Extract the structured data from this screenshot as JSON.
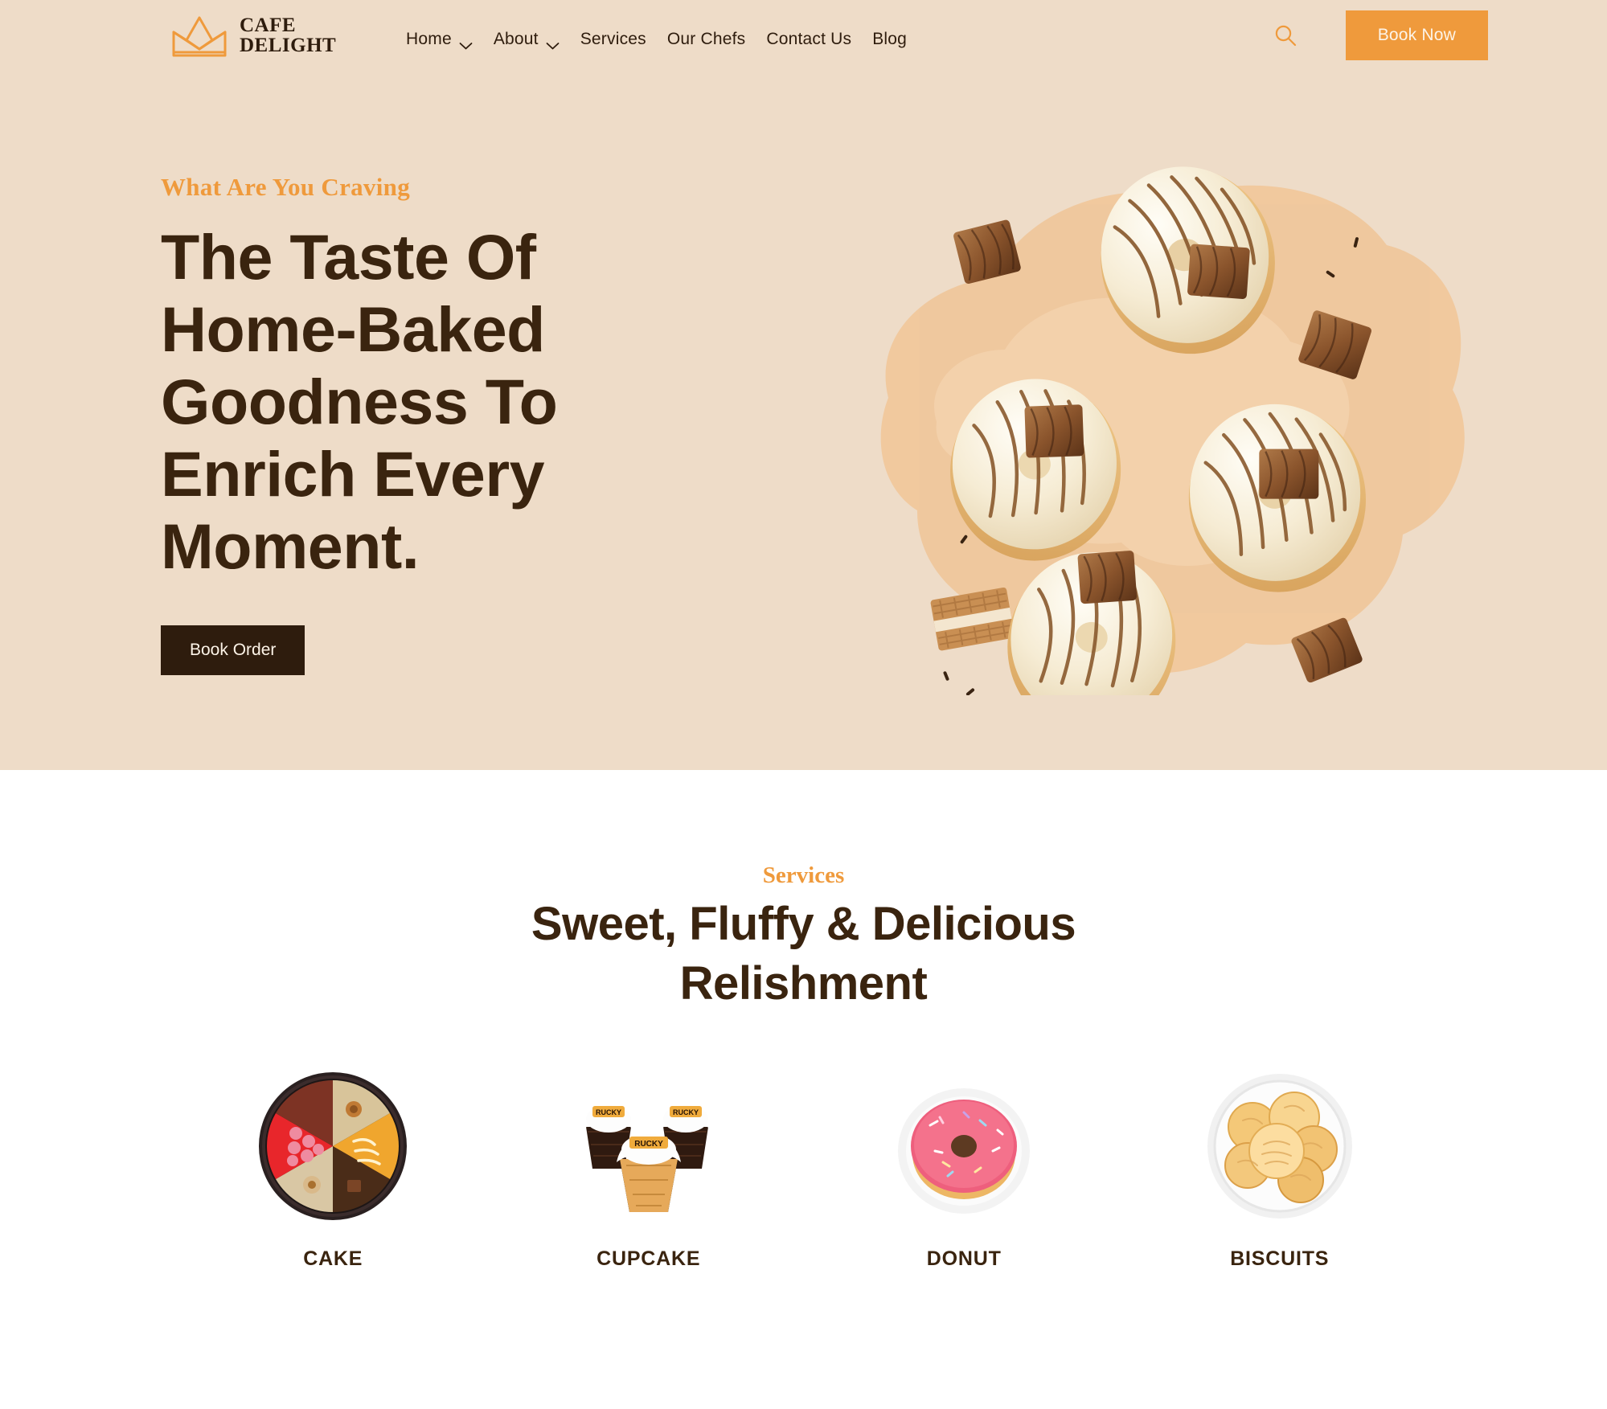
{
  "header": {
    "brand": {
      "icon": "crown-icon",
      "line1": "CAFE",
      "line2": "DELIGHT"
    },
    "nav": [
      {
        "label": "Home",
        "has_dropdown": true,
        "icon": "chevron-down-icon"
      },
      {
        "label": "About",
        "has_dropdown": true,
        "icon": "chevron-down-icon"
      },
      {
        "label": "Services",
        "has_dropdown": false
      },
      {
        "label": "Our Chefs",
        "has_dropdown": false
      },
      {
        "label": "Contact Us",
        "has_dropdown": false
      },
      {
        "label": "Blog",
        "has_dropdown": false
      }
    ],
    "search_icon": "search-icon",
    "book_now_label": "Book Now"
  },
  "hero": {
    "eyebrow": "What Are You Craving",
    "title": "The Taste Of\nHome-Baked\nGoodness To\nEnrich Every\nMoment.",
    "cta_label": "Book Order",
    "art_alt": "white-chocolate-glazed-donuts-with-chocolate-drizzle"
  },
  "services": {
    "eyebrow": "Services",
    "title": "Sweet, Fluffy & Delicious\nRelishment",
    "items": [
      {
        "label": "CAKE",
        "image": "assorted-cake-slices-platter"
      },
      {
        "label": "CUPCAKE",
        "image": "three-frosted-cupcakes"
      },
      {
        "label": "DONUT",
        "image": "pink-glazed-donut-with-sprinkles"
      },
      {
        "label": "BISCUITS",
        "image": "bowl-of-golden-biscuits"
      }
    ]
  },
  "colors": {
    "hero_background": "#EEDCC8",
    "accent_orange": "#EF9A3C",
    "dark_brown": "#2E1C0D",
    "heading_brown": "#3A240F",
    "page_background": "#FFFFFF",
    "cream_text": "#FDF4E8"
  }
}
